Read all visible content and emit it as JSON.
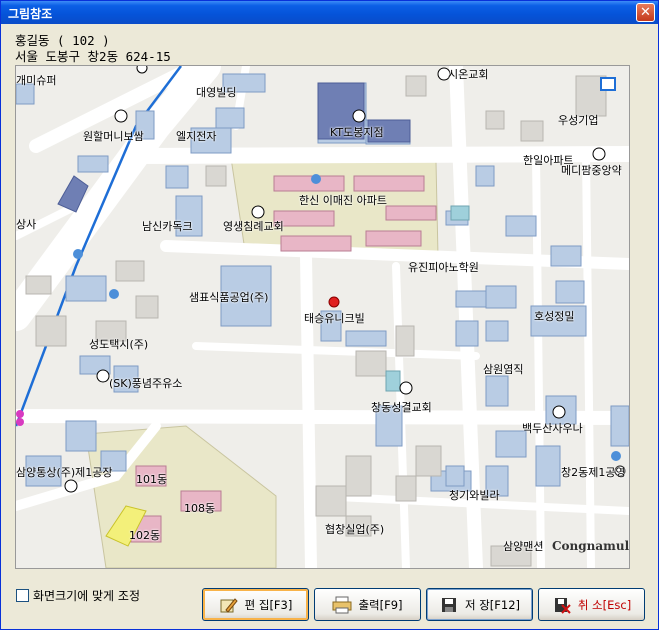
{
  "window": {
    "title": "그림참조",
    "close_glyph": "✕"
  },
  "info": {
    "name_line": "홍길동 ( 102 )",
    "address_line": "서울 도봉구 창2동 624-15"
  },
  "map": {
    "labels": [
      {
        "text": "개미슈퍼"
      },
      {
        "text": "대영빌딩"
      },
      {
        "text": "시온교회"
      },
      {
        "text": "KT도봉지점"
      },
      {
        "text": "원할머니보쌈"
      },
      {
        "text": "엘지전자"
      },
      {
        "text": "우성기업"
      },
      {
        "text": "한일아파트"
      },
      {
        "text": "메디팜중앙약"
      },
      {
        "text": "상사"
      },
      {
        "text": "한신 이매진 아파트"
      },
      {
        "text": "남신카독크"
      },
      {
        "text": "영생침례교회"
      },
      {
        "text": "유진피아노학원"
      },
      {
        "text": "샘표식품공업(주)"
      },
      {
        "text": "호성정밀"
      },
      {
        "text": "태승유니크빌"
      },
      {
        "text": "성도택시(주)"
      },
      {
        "text": "삼원염직"
      },
      {
        "text": "(SK)풍념주유소"
      },
      {
        "text": "창동성결교회"
      },
      {
        "text": "백두산사우나"
      },
      {
        "text": "삼양통상(주)제1공장"
      },
      {
        "text": "창2동제1공영"
      },
      {
        "text": "101동"
      },
      {
        "text": "108동"
      },
      {
        "text": "청기와빌라"
      },
      {
        "text": "102동"
      },
      {
        "text": "협창실업(주)"
      },
      {
        "text": "삼양맨션"
      }
    ],
    "brand": "Congnamul"
  },
  "footer": {
    "fit_label": "화면크기에 맞게 조정",
    "edit_label": "편 집[F3]",
    "print_label": "출력[F9]",
    "save_label": "저 장[F12]",
    "cancel_label": "취 소[Esc]"
  },
  "colors": {
    "road": "#FFFFFF",
    "block": "#EEEDE8",
    "building": "#B9CCE4",
    "building_border": "#7E9BC4",
    "apartment": "#E8B6C6",
    "apt_zone": "#E9E7C8",
    "subway": "#1E6ED6"
  }
}
